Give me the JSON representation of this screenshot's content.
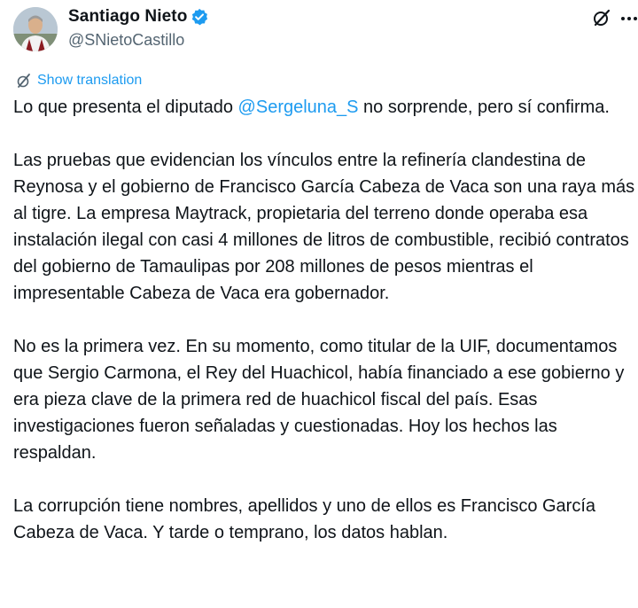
{
  "author": {
    "name": "Santiago Nieto",
    "handle": "@SNietoCastillo",
    "verified": true
  },
  "icons": {
    "avatar": "avatar",
    "verified": "verified-badge-icon",
    "grok": "grok-icon",
    "more": "more-icon",
    "translate": "translate-icon"
  },
  "colors": {
    "link": "#1d9bf0",
    "text": "#0f1419",
    "secondary": "#536471",
    "verified": "#1d9bf0"
  },
  "translate": {
    "label": "Show translation"
  },
  "tweet": {
    "p1_before": "Lo que presenta el diputado ",
    "p1_mention": "@Sergeluna_S",
    "p1_after": " no sorprende, pero sí confirma.",
    "p2": "Las pruebas que evidencian los vínculos entre la refinería clandestina de Reynosa y el gobierno de Francisco García Cabeza de Vaca son una raya más al tigre. La empresa Maytrack, propietaria del terreno donde operaba esa instalación ilegal con casi 4 millones de litros de combustible, recibió contratos del gobierno de Tamaulipas por 208 millones de pesos mientras el impresentable Cabeza de Vaca era gobernador.",
    "p3": "No es la primera vez. En su momento, como titular de la UIF, documentamos que Sergio Carmona, el Rey del Huachicol, había financiado a ese gobierno y era pieza clave de la primera red de huachicol fiscal del país. Esas investigaciones fueron señaladas y cuestionadas. Hoy los hechos las respaldan.",
    "p4": "La corrupción tiene nombres, apellidos y uno de ellos es Francisco García Cabeza de Vaca. Y tarde o temprano, los datos hablan."
  }
}
